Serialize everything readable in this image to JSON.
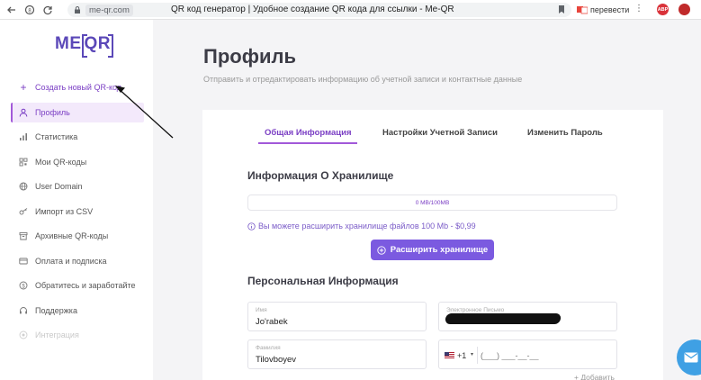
{
  "browser": {
    "host": "me-qr.com",
    "tab_title": "QR код генератор | Удобное создание QR кода для ссылки - Me-QR",
    "translate_label": "перевести",
    "abp_label": "ABP",
    "more_label": "⋮"
  },
  "logo": {
    "me": "ME",
    "qr": "QR"
  },
  "sidebar": {
    "create_label": "Создать новый QR-код",
    "items": [
      {
        "label": "Профиль",
        "icon": "user-icon"
      },
      {
        "label": "Статистика",
        "icon": "bar-chart-icon"
      },
      {
        "label": "Мои QR-коды",
        "icon": "qr-grid-icon"
      },
      {
        "label": "User Domain",
        "icon": "globe-icon"
      },
      {
        "label": "Импорт из CSV",
        "icon": "key-icon"
      },
      {
        "label": "Архивные QR-коды",
        "icon": "archive-icon"
      },
      {
        "label": "Оплата и подписка",
        "icon": "card-icon"
      },
      {
        "label": "Обратитесь и заработайте",
        "icon": "dollar-icon"
      },
      {
        "label": "Поддержка",
        "icon": "headset-icon"
      },
      {
        "label": "Интеграция",
        "icon": "puzzle-icon"
      }
    ]
  },
  "main": {
    "title": "Профиль",
    "subtitle": "Отправить и отредактировать информацию об учетной записи и контактные данные",
    "tabs": [
      {
        "label": "Общая Информация"
      },
      {
        "label": "Настройки Учетной Записи"
      },
      {
        "label": "Изменить Пароль"
      }
    ],
    "storage": {
      "heading": "Информация О Хранилище",
      "usage_text": "0 MB/100MB",
      "usage_fraction": 0,
      "note": "Вы можете расширить хранилище файлов 100 Mb - $0,99",
      "expand_button": "Расширить хранилище"
    },
    "personal": {
      "heading": "Персональная Информация",
      "first_name_label": "Имя",
      "first_name_value": "Jo'rabek",
      "email_label": "Электронное Письмо",
      "last_name_label": "Фамилия",
      "last_name_value": "Tilovboyev",
      "phone_code": "+1",
      "phone_placeholder": "(___) ___-__-__",
      "add_link": "+ Добавить"
    }
  },
  "colors": {
    "accent": "#7b3fc4",
    "button": "#7b5ae0",
    "active_bg": "#f3e9fb",
    "chat": "#3fa0e4"
  }
}
